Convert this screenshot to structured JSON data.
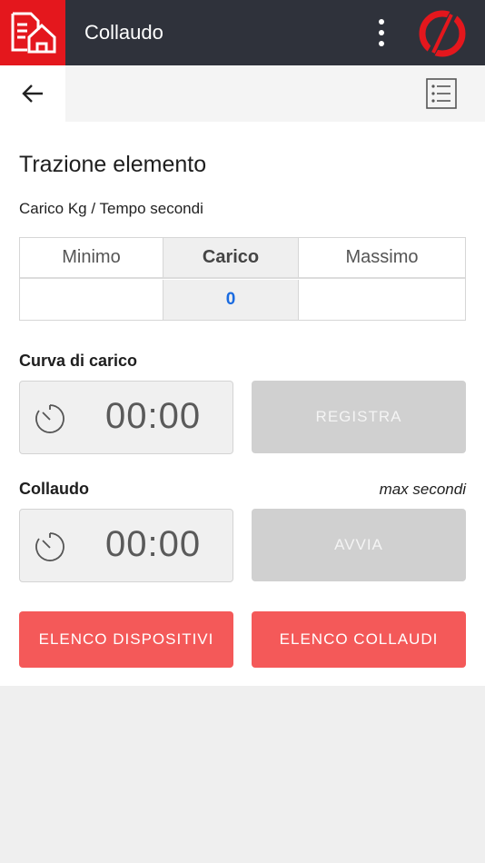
{
  "header": {
    "title": "Collaudo",
    "app_icon": "document-house-icon",
    "menu_icon": "more-vertical-icon",
    "brand_logo": "brand-logo",
    "accent_color": "#e4171d",
    "bar_color": "#2f323b"
  },
  "toolbar": {
    "back_icon": "arrow-left-icon",
    "list_icon": "list-icon"
  },
  "page": {
    "title": "Trazione elemento",
    "subtitle": "Carico Kg / Tempo secondi"
  },
  "load_table": {
    "headers": [
      "Minimo",
      "Carico",
      "Massimo"
    ],
    "values": [
      "",
      "0",
      ""
    ]
  },
  "load_curve": {
    "label": "Curva di carico",
    "timer": "00:00",
    "button_label": "REGISTRA"
  },
  "test": {
    "label": "Collaudo",
    "note": "max secondi",
    "timer": "00:00",
    "button_label": "AVVIA"
  },
  "actions": {
    "devices_label": "ELENCO DISPOSITIVI",
    "tests_label": "ELENCO COLLAUDI",
    "button_color": "#f45959"
  }
}
